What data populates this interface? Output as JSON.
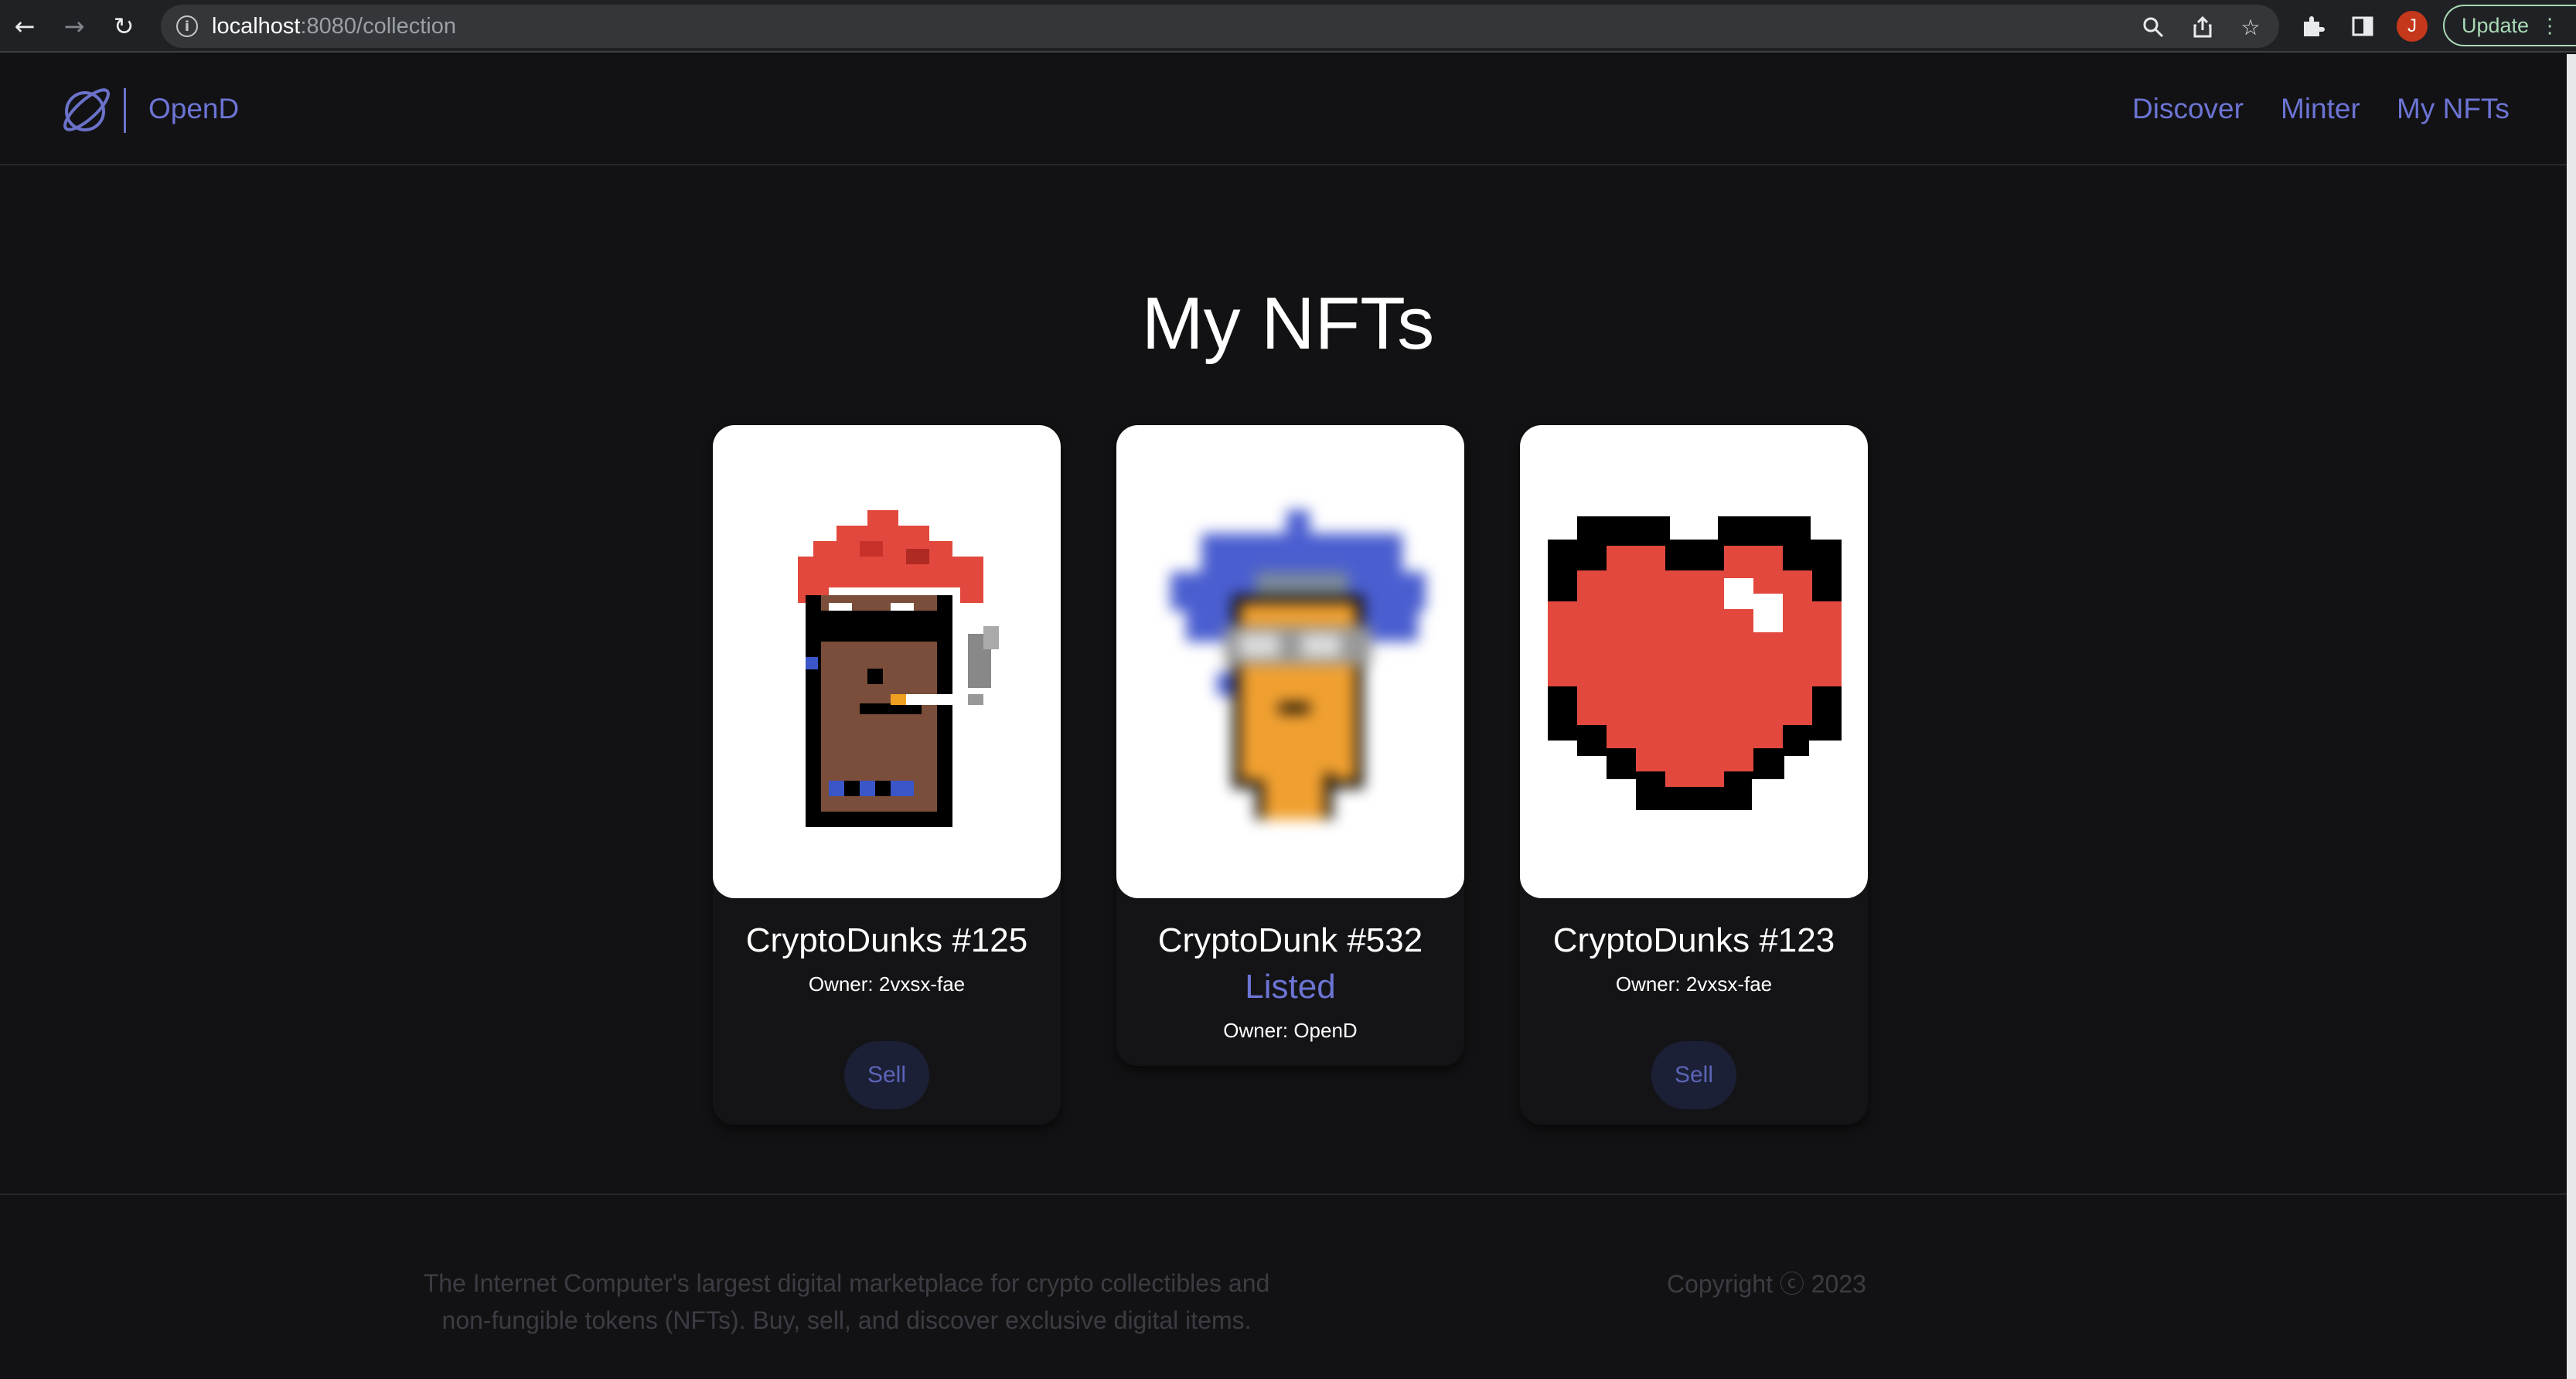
{
  "browser": {
    "url_host": "localhost",
    "url_path": ":8080/collection",
    "update_label": "Update",
    "profile_initial": "J"
  },
  "header": {
    "brand": "OpenD",
    "nav": [
      {
        "label": "Discover"
      },
      {
        "label": "Minter"
      },
      {
        "label": "My NFTs"
      }
    ]
  },
  "page": {
    "title": "My NFTs"
  },
  "cards": [
    {
      "name": "CryptoDunks #125",
      "owner": "Owner: 2vxsx-fae",
      "sell_label": "Sell",
      "image": "punk-red-hair"
    },
    {
      "name": "CryptoDunk #532",
      "status": "Listed",
      "owner": "Owner: OpenD",
      "image": "punk-blue-hair"
    },
    {
      "name": "CryptoDunks #123",
      "owner": "Owner: 2vxsx-fae",
      "sell_label": "Sell",
      "image": "pixel-heart"
    }
  ],
  "footer": {
    "description": "The Internet Computer's largest digital marketplace for crypto collectibles and non-fungible tokens (NFTs). Buy, sell, and discover exclusive digital items.",
    "copyright": "Copyright ⓒ 2023"
  },
  "colors": {
    "accent": "#6c74d4",
    "background": "#121214",
    "sell_button_bg": "#1b2036"
  }
}
